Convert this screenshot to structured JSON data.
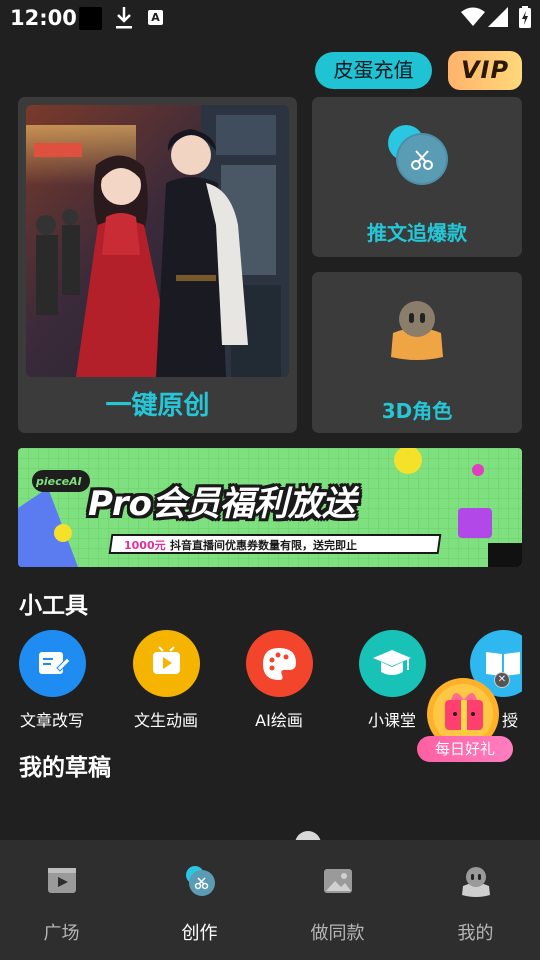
{
  "status_bar": {
    "time": "12:00",
    "a_badge": "A"
  },
  "header": {
    "recharge_label": "皮蛋充值",
    "vip_label": "VIP"
  },
  "cards": {
    "main": {
      "label": "一键原创"
    },
    "trend": {
      "label": "推文追爆款",
      "icon": "scissors-icon"
    },
    "role3d": {
      "label": "3D角色",
      "icon": "avatar-icon"
    }
  },
  "banner": {
    "brand": "pieceAI",
    "headline": "Pro会员福利放送",
    "subline_prefix": "1000元",
    "subline": "抖音直播间优惠券数量有限，送完即止"
  },
  "tools": {
    "title": "小工具",
    "items": [
      {
        "label": "文章改写",
        "icon": "edit-icon",
        "color": "#1e8cf0"
      },
      {
        "label": "文生动画",
        "icon": "video-icon",
        "color": "#f5b400"
      },
      {
        "label": "AI绘画",
        "icon": "palette-icon",
        "color": "#f2452b"
      },
      {
        "label": "小课堂",
        "icon": "graduation-cap-icon",
        "color": "#19c2b6"
      },
      {
        "label": "授",
        "icon": "book-icon",
        "color": "#2fb7f0"
      }
    ]
  },
  "gift": {
    "label": "每日好礼"
  },
  "drafts": {
    "title": "我的草稿"
  },
  "bottom_nav": {
    "items": [
      {
        "label": "广场",
        "icon": "film-icon"
      },
      {
        "label": "创作",
        "icon": "scissors-icon"
      },
      {
        "label": "做同款",
        "icon": "image-icon"
      },
      {
        "label": "我的",
        "icon": "user-icon"
      }
    ]
  },
  "colors": {
    "accent": "#25c7d7",
    "background": "#202020",
    "card": "#3b3b3b",
    "nav": "#2e2e2e"
  }
}
